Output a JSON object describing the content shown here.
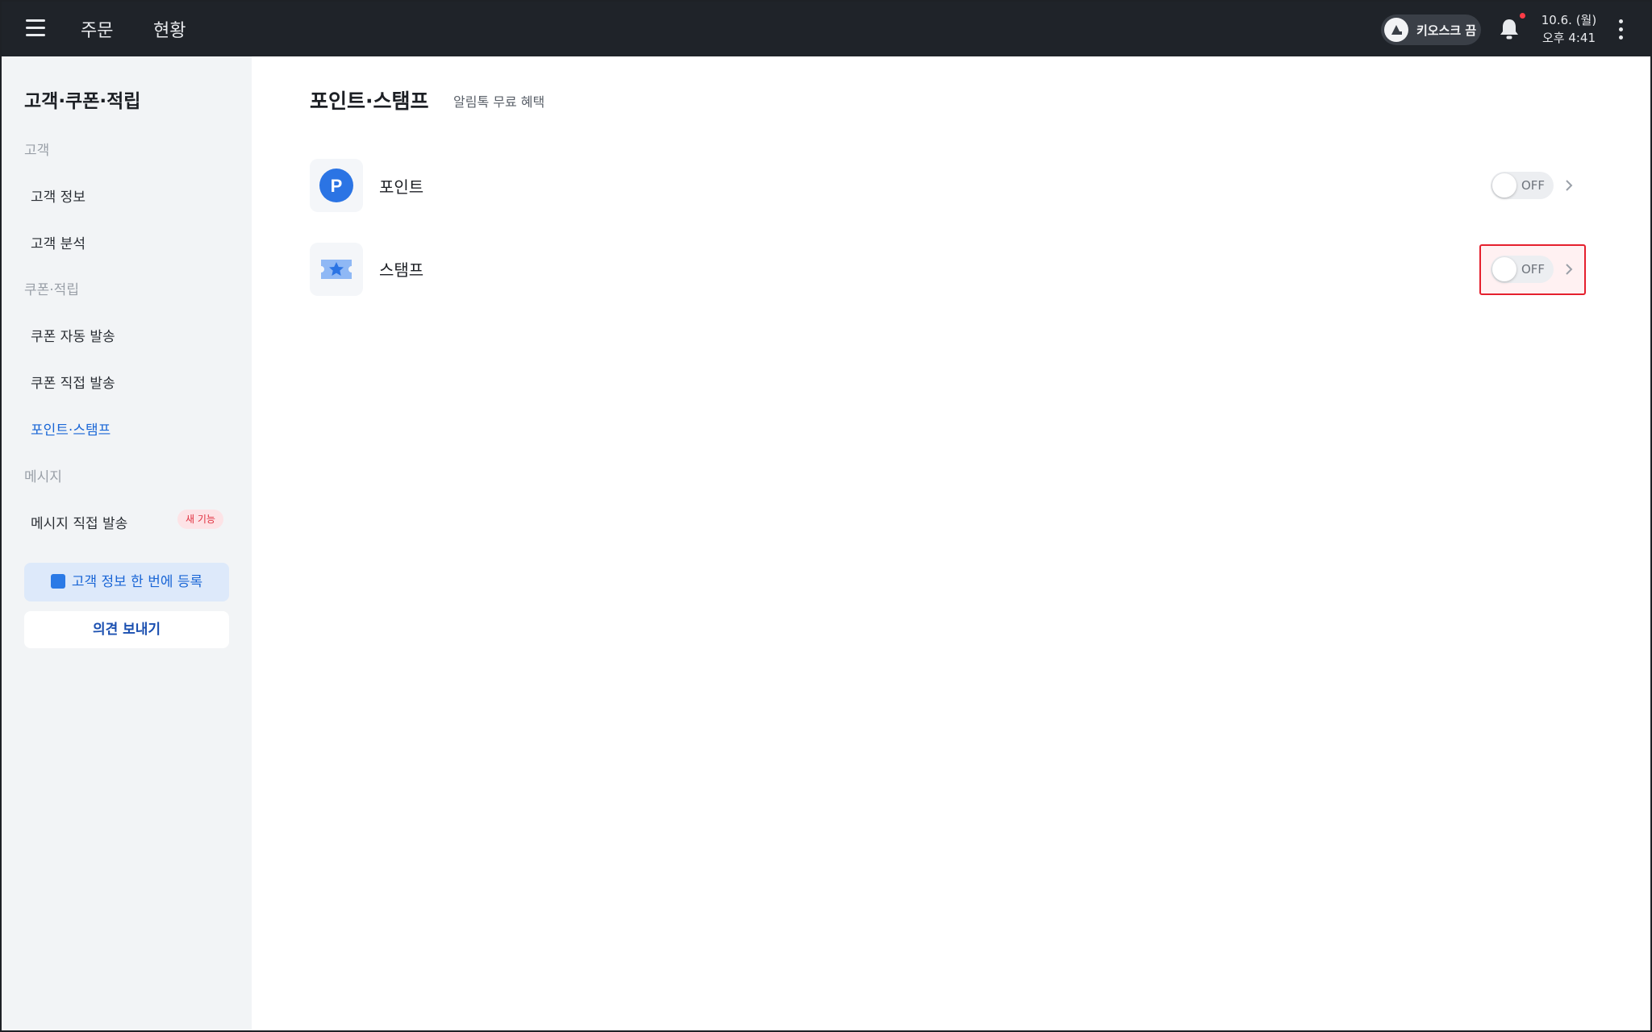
{
  "topbar": {
    "tabs": [
      {
        "label": "주문"
      },
      {
        "label": "현황"
      }
    ],
    "kiosk": {
      "label": "키오스크 끔"
    },
    "date": "10.6. (월)",
    "time": "오후 4:41"
  },
  "sidebar": {
    "title": "고객·쿠폰·적립",
    "sections": [
      {
        "label": "고객"
      },
      {
        "label": "쿠폰·적립"
      },
      {
        "label": "메시지"
      }
    ],
    "items": [
      {
        "label": "고객 정보"
      },
      {
        "label": "고객 분석"
      },
      {
        "label": "쿠폰 자동 발송"
      },
      {
        "label": "쿠폰 직접 발송"
      },
      {
        "label": "포인트·스탬프"
      },
      {
        "label": "메시지 직접 발송"
      }
    ],
    "new_badge": "새 기능",
    "register_button": "고객 정보 한 번에 등록",
    "feedback_button": "의견 보내기"
  },
  "main": {
    "title": "포인트·스탬프",
    "subtitle": "알림톡 무료 혜택",
    "rows": [
      {
        "label": "포인트",
        "icon": "point-icon",
        "toggle": "OFF"
      },
      {
        "label": "스탬프",
        "icon": "stamp-icon",
        "toggle": "OFF"
      }
    ],
    "point_glyph": "P"
  },
  "colors": {
    "topbar": "#1f2329",
    "accent": "#1a66d6",
    "highlight": "#e5202e"
  }
}
